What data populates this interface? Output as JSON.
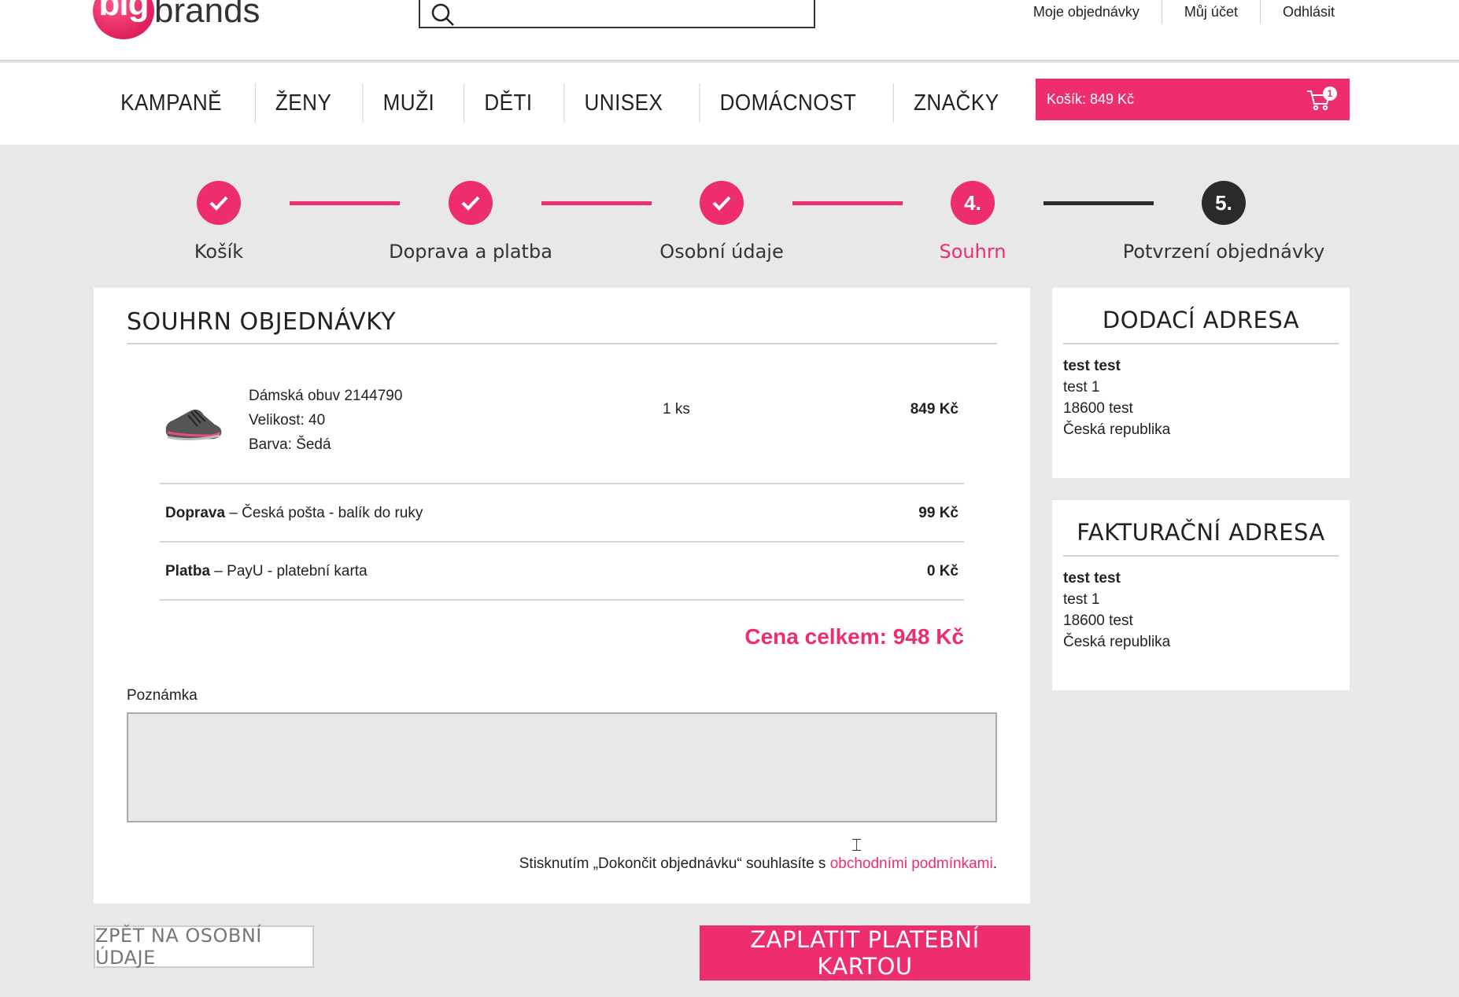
{
  "header": {
    "logo_big": "big",
    "logo_brands": "brands",
    "links": [
      "Moje objednávky",
      "Můj účet",
      "Odhlásit"
    ]
  },
  "nav": {
    "items": [
      "KAMPANĚ",
      "ŽENY",
      "MUŽI",
      "DĚTI",
      "UNISEX",
      "DOMÁCNOST",
      "ZNAČKY"
    ],
    "cart_label": "Košík: 849 Kč",
    "cart_count": "1"
  },
  "steps": {
    "items": [
      {
        "label": "Košík",
        "marker": "check",
        "state": "done"
      },
      {
        "label": "Doprava a platba",
        "marker": "check",
        "state": "done"
      },
      {
        "label": "Osobní údaje",
        "marker": "check",
        "state": "done"
      },
      {
        "label": "Souhrn",
        "marker": "4.",
        "state": "active"
      },
      {
        "label": "Potvrzení objednávky",
        "marker": "5.",
        "state": "pending"
      }
    ]
  },
  "summary": {
    "title": "SOUHRN OBJEDNÁVKY",
    "product": {
      "name": "Dámská obuv 2144790",
      "size": "Velikost: 40",
      "color": "Barva: Šedá",
      "qty": "1 ks",
      "price": "849 Kč"
    },
    "shipping": {
      "label": "Doprava",
      "detail": " – Česká pošta - balík do ruky",
      "price": "99 Kč"
    },
    "payment": {
      "label": "Platba",
      "detail": " – PayU - platební karta",
      "price": "0 Kč"
    },
    "total": "Cena celkem: 948 Kč",
    "note_label": "Poznámka",
    "note_value": "",
    "terms_text": "Stisknutím „Dokončit objednávku“ souhlasíte s ",
    "terms_link": "obchodními podmínkami",
    "terms_end": "."
  },
  "delivery_address": {
    "title": "DODACÍ ADRESA",
    "name": "test test",
    "street": "test 1",
    "city": "18600 test",
    "country": "Česká republika"
  },
  "billing_address": {
    "title": "FAKTURAČNÍ ADRESA",
    "name": "test test",
    "street": "test 1",
    "city": "18600 test",
    "country": "Česká republika"
  },
  "buttons": {
    "back": "ZPĚT NA OSOBNÍ ÚDAJE",
    "pay": "ZAPLATIT PLATEBNÍ KARTOU"
  },
  "colors": {
    "accent": "#ee2e6c",
    "dark": "#2a2a2a",
    "background": "#e8e8e8"
  }
}
